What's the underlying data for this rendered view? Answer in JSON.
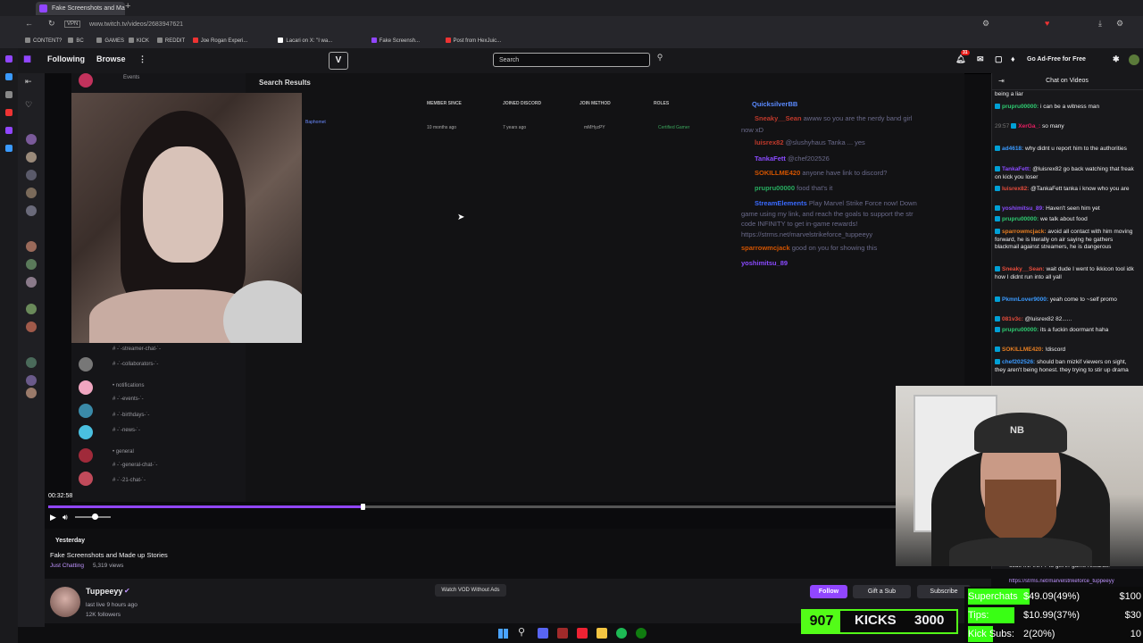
{
  "browser": {
    "tab_title": "Fake Screenshots and Ma",
    "new_tab": "+",
    "url": "www.twitch.tv/videos/2683947621",
    "vpn_label": "VPN",
    "bookmarks": [
      {
        "label": "CONTENT?",
        "color": "#888888"
      },
      {
        "label": "BC",
        "color": "#888888"
      },
      {
        "label": "GAMES",
        "color": "#888888"
      },
      {
        "label": "KICK",
        "color": "#888888"
      },
      {
        "label": "REDDIT",
        "color": "#888888"
      },
      {
        "label": "Joe Rogan Experi...",
        "color": "#e33"
      },
      {
        "label": "Lacari on X: \"I wa...",
        "color": "#ffffff"
      },
      {
        "label": "Fake Screensh...",
        "color": "#9146ff"
      },
      {
        "label": "Post from HexJuic...",
        "color": "#e33"
      }
    ]
  },
  "twitch_nav": {
    "following": "Following",
    "browse": "Browse",
    "more": "⋮",
    "search_placeholder": "Search",
    "notif_count": "31",
    "ad_free": "Go Ad-Free for Free"
  },
  "video": {
    "screenshot": {
      "search_results_title": "Search Results",
      "events": "Events",
      "columns": [
        "MEMBER SINCE",
        "JOINED DISCORD",
        "JOIN METHOD",
        "ROLES"
      ],
      "row": {
        "member_since": "10 months ago",
        "joined_discord": "7 years ago",
        "join_method": "mMHyzPY",
        "roles": "Certified Gamer"
      },
      "channels": [
        "# -˙-streamer-chat-˙-",
        "# -˙-collaborators-˙-",
        "• notifications",
        "# -˙-events-˙-",
        "# -˙-birthdays-˙-",
        "# -˙-news-˙-",
        "• general",
        "# -˙-general-chat-˙-",
        "# -˙-21-chat-˙-"
      ],
      "chat": [
        {
          "user": "QuicksilverBB",
          "text": "",
          "color": "#5a8aff"
        },
        {
          "user": "Sneaky__Sean",
          "text": "awww so you are the nerdy band girl",
          "color": "#c0392b"
        },
        {
          "user": "",
          "text": "now xD",
          "color": "#6a6a8a"
        },
        {
          "user": "luisrex82",
          "text": "@slushyhaus Tanka ... yes",
          "color": "#c0392b"
        },
        {
          "user": "TankaFett",
          "text": "@chef202526",
          "color": "#8a4aff"
        },
        {
          "user": "SOKILLME420",
          "text": "anyone have link to discord?",
          "color": "#d35400"
        },
        {
          "user": "prupru00000",
          "text": "food that's it",
          "color": "#27ae60"
        },
        {
          "user": "StreamElements",
          "text": "Play Marvel Strike Force now! Down",
          "color": "#3a6aff"
        },
        {
          "user": "",
          "text": "game using my link, and reach the goals to support the str",
          "color": "#6a6a8a"
        },
        {
          "user": "",
          "text": "code INFINITY to get in-game rewards!",
          "color": "#6a6a8a"
        },
        {
          "user": "",
          "text": "https://strms.net/marvelstrikeforce_tuppeeyy",
          "color": "#6a6a8a"
        },
        {
          "user": "sparrowmcjack",
          "text": "good on you for showing this",
          "color": "#d35400"
        },
        {
          "user": "yoshimitsu_89",
          "text": "",
          "color": "#8a4aff"
        }
      ]
    },
    "timecode": "00:32:58",
    "progress": 0.37,
    "volume": 0.55
  },
  "video_info": {
    "date": "Yesterday",
    "title": "Fake Screenshots and Made up Stories",
    "category": "Just Chatting",
    "views": "5,319 views",
    "channel": "Tuppeeyy",
    "last_live": "last live 9 hours ago",
    "followers": "12K followers",
    "watch_vod": "Watch VOD Without Ads",
    "follow": "Follow",
    "gift_sub": "Gift a Sub",
    "subscribe": "Subscribe"
  },
  "chat": {
    "header": "Chat on Videos",
    "messages": [
      {
        "ts": "",
        "user": "",
        "color": "#efeff1",
        "text": "being a liar"
      },
      {
        "ts": "",
        "user": "prupru00000:",
        "color": "#2ecc71",
        "text": "i can be a witness man"
      },
      {
        "ts": "29:57",
        "user": "XerGa_:",
        "color": "#e91e63",
        "text": "so many"
      },
      {
        "ts": "",
        "user": "ad4618:",
        "color": "#3a9aff",
        "text": "why didnt u report him to the authorities"
      },
      {
        "ts": "",
        "user": "TankaFett:",
        "color": "#8a4aff",
        "text": "@luisrex82 go back watching that freak on kick you loser"
      },
      {
        "ts": "",
        "user": "luisrex82:",
        "color": "#e74c3c",
        "text": "@TankaFett tanka i know who you are"
      },
      {
        "ts": "",
        "user": "yoshimitsu_89:",
        "color": "#8a4aff",
        "text": "Haven't seen him yet"
      },
      {
        "ts": "",
        "user": "prupru00000:",
        "color": "#2ecc71",
        "text": "we talk about food"
      },
      {
        "ts": "",
        "user": "sparrowmcjack:",
        "color": "#e67e22",
        "text": "avoid all contact with him moving forward, he is literally on air saying he gathers blackmail against streamers, he is dangerous"
      },
      {
        "ts": "",
        "user": "Sneaky__Sean:",
        "color": "#e74c3c",
        "text": "wait dude I went to ikkicon tool idk how I didnt run into all yall"
      },
      {
        "ts": "",
        "user": "PkmnLover9000:",
        "color": "#3a9aff",
        "text": "yeah come to ~self promo"
      },
      {
        "ts": "",
        "user": "081v3c:",
        "color": "#e74c3c",
        "text": "@luisrex82 82......"
      },
      {
        "ts": "",
        "user": "prupru00000:",
        "color": "#2ecc71",
        "text": "its a fuckin doormant haha"
      },
      {
        "ts": "",
        "user": "SOKILLME420:",
        "color": "#e67e22",
        "text": "!discord"
      },
      {
        "ts": "",
        "user": "chef202526:",
        "color": "#3a9aff",
        "text": "should ban mizkif viewers on sight, they aren't being honest. they trying to stir up drama"
      }
    ],
    "tail": "code INFINITY to get in-game rewards!",
    "tail_link": "https://strms.net/marvelstrikeforce_tuppeeyy"
  },
  "overlay": {
    "kicks_count": "907",
    "kicks_label": "KICKS",
    "kicks_goal": "3000",
    "rows": [
      {
        "label": "Superchats",
        "value": "$49.09(49%)",
        "goal": "$100",
        "fraction": 0.49
      },
      {
        "label": "Tips:",
        "value": "$10.99(37%)",
        "goal": "$30",
        "fraction": 0.37
      },
      {
        "label": "Kick Subs:",
        "value": "2(20%)",
        "goal": "10",
        "fraction": 0.2
      }
    ]
  },
  "colors": {
    "accent": "#9146ff",
    "kick_green": "#53fc18",
    "bar_green": "#39ff14"
  }
}
